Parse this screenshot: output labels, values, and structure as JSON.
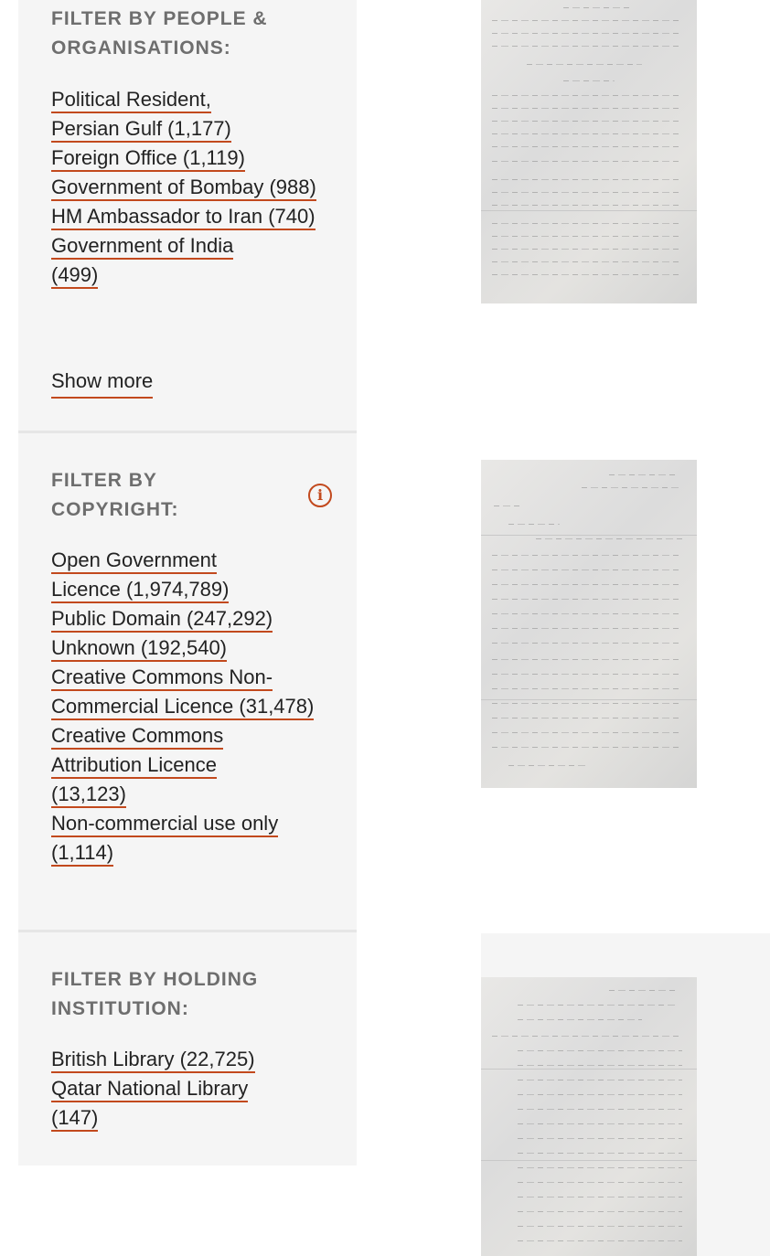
{
  "filters": {
    "people": {
      "heading": "FILTER BY PEOPLE & ORGANISATIONS:",
      "items": [
        {
          "label": "Political Resident, Persian Gulf (1,177)"
        },
        {
          "label": "Foreign Office (1,119)"
        },
        {
          "label": "Government of Bombay (988)"
        },
        {
          "label": "HM Ambassador to Iran (740)"
        },
        {
          "label": "Government of India (499)"
        }
      ],
      "show_more": "Show more"
    },
    "copyright": {
      "heading": "FILTER BY COPYRIGHT:",
      "info_icon": "info-icon",
      "items": [
        {
          "label": "Open Government Licence (1,974,789)"
        },
        {
          "label": "Public Domain (247,292)"
        },
        {
          "label": "Unknown (192,540)"
        },
        {
          "label": "Creative Commons Non-Commercial Licence (31,478)"
        },
        {
          "label": "Creative Commons Attribution Licence (13,123)"
        },
        {
          "label": "Non-commercial use only (1,114)"
        }
      ]
    },
    "holding": {
      "heading": "FILTER BY HOLDING INSTITUTION:",
      "items": [
        {
          "label": "British Library (22,725)"
        },
        {
          "label": "Qatar National Library (147)"
        }
      ]
    }
  },
  "colors": {
    "accent": "#c2491d",
    "panel_bg": "#f5f5f5",
    "heading": "#6e6e6e",
    "text": "#222222"
  }
}
